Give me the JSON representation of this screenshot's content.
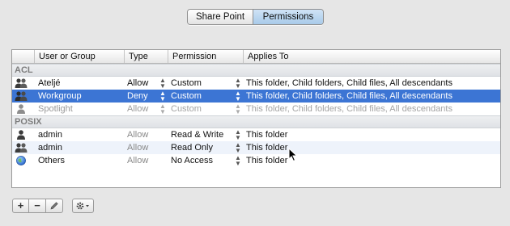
{
  "tabs": [
    {
      "label": "Share Point",
      "active": false
    },
    {
      "label": "Permissions",
      "active": true
    }
  ],
  "table": {
    "columns": [
      "User or Group",
      "Type",
      "Permission",
      "Applies To"
    ],
    "acl_label": "ACL",
    "posix_label": "POSIX",
    "acl_rows": [
      {
        "icon": "group-icon",
        "name": "Ateljé",
        "type": "Allow",
        "permission": "Custom",
        "applies": "This folder, Child folders, Child files, All descendants"
      },
      {
        "icon": "group-icon",
        "name": "Workgroup",
        "type": "Deny",
        "permission": "Custom",
        "applies": "This folder, Child folders, Child files, All descendants",
        "selected": true
      },
      {
        "icon": "user-icon",
        "name": "Spotlight",
        "type": "Allow",
        "permission": "Custom",
        "applies": "This folder, Child folders, Child files, All descendants",
        "dimmed": true
      }
    ],
    "posix_rows": [
      {
        "icon": "user-icon",
        "name": "admin",
        "type": "Allow",
        "permission": "Read & Write",
        "applies": "This folder"
      },
      {
        "icon": "group-icon",
        "name": "admin",
        "type": "Allow",
        "permission": "Read Only",
        "applies": "This folder"
      },
      {
        "icon": "globe-icon",
        "name": "Others",
        "type": "Allow",
        "permission": "No Access",
        "applies": "This folder"
      }
    ]
  },
  "toolbar": {
    "add_label": "+",
    "remove_label": "−",
    "edit_icon": "pencil-icon",
    "action_icon": "gear-icon"
  },
  "colors": {
    "selection": "#3c75d4",
    "active_tab": "#b6d2ee"
  }
}
